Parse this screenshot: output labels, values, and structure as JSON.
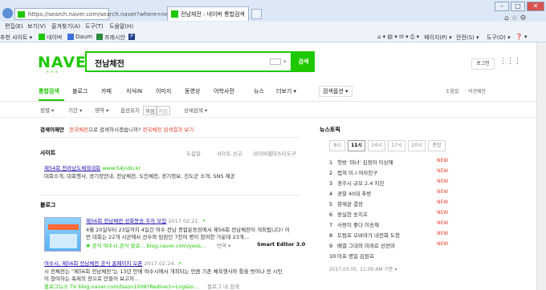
{
  "browser": {
    "address": "https://search.naver.com/search.naver?where=nex",
    "tab_title": "전남체전 : 네이버 통합검색",
    "menu": [
      "편집(E)",
      "보기(V)",
      "즐겨찾기(A)",
      "도구(T)",
      "도움말(H)"
    ],
    "favorites": [
      "추천 사이트 ▾",
      "네이버",
      "Daum",
      "프레시안"
    ],
    "toolbar_right": [
      "페이지(P) ▾",
      "안전(S) ▾",
      "도구(O) ▾"
    ]
  },
  "search": {
    "logo": "NAVER",
    "query": "전남체전",
    "button": "검색",
    "login": "로그인"
  },
  "nav": {
    "items": [
      "통합검색",
      "블로그",
      "카페",
      "지식iN",
      "이미지",
      "동영상",
      "어학사전",
      "뉴스",
      "더보기 ▾"
    ],
    "options": "검색옵션 ▾",
    "right": [
      "도움말",
      "의견제안"
    ]
  },
  "filters": [
    "정렬 ▾",
    "기간 ▾",
    "영역 ▾",
    "옵션유지",
    "꺼짐",
    "켜짐",
    "상세검색 ▾"
  ],
  "suggest": {
    "label": "검색어제안",
    "text_pre": "",
    "link1": "전국체전",
    "text_mid": "으로 검색하시겠습니까?",
    "link2": "전국체전 검색결과 보기"
  },
  "site": {
    "title": "사이트",
    "actions": [
      "도움말",
      "사이트 신고",
      "네이버웹마스터도구"
    ],
    "result_title": "제54회 전라남도체육대회",
    "result_url": "www.54jndo.kr",
    "result_desc": "대회소개, 대회행사, 경기장안내, 전남체전, 도민체전, 경기정보, 진도군 소개, SNS 제공"
  },
  "blog": {
    "title": "블로그",
    "items": [
      {
        "title": "제56회 전남체전 성화봉송 주자 모집",
        "date": "2017.02.21.",
        "desc1": "4월 20일부터 23일까지 4일간 여수 전남 종합운동장에서 제56회 전남체전이 개최됩니다! 이",
        "desc2": "번 대회는 22개 시군에서 선수와 임원단 7천여 명이 참여한 가운데 23개...",
        "source": "✚ 공식 여수시 공식 블로... blog.naver.com/yeos...",
        "extra": "번역 ▾",
        "editor": "Smart Editor 3.0"
      },
      {
        "title": "여수시, 제56회 전남체전 공식 홈페이지 오픈",
        "date": "2017.02.24.",
        "desc1": "시 전체전는 \"제56회 전남체전\"는 13년 만에 여수시에서 개최되는 만큼 기존 체육행사와 틀을 벗어나 전 시민",
        "desc2": "이 참여하는 축제의 장으로 만들어 보고자...",
        "source": "블로그뉴스 TV  blog.naver.com/lsson1008?Redirect=Log&lo...",
        "extra": "블로그 내 검색"
      }
    ]
  },
  "news_rank": {
    "title": "뉴스토픽",
    "tabs": [
      "8시",
      "11시",
      "14시",
      "17시",
      "20시",
      "종합"
    ],
    "active_tab": 1,
    "items": [
      "첫방 '마녀' 김정아 이상해",
      "캡쳐 이-I 여자친구",
      "경주시 규모 2.4 지진",
      "경찰 40대 추방",
      "향재균 결장",
      "왕실현 송치호",
      "사랑이 좋다 이송재",
      "트럼프 오바마가 내전화 도청",
      "배열 그대와 미래로 선전마",
      "아프 명일 김원효"
    ],
    "new_label": "NEW",
    "footer": "2017.03.05. 11:00 AM 기준 ▾"
  }
}
